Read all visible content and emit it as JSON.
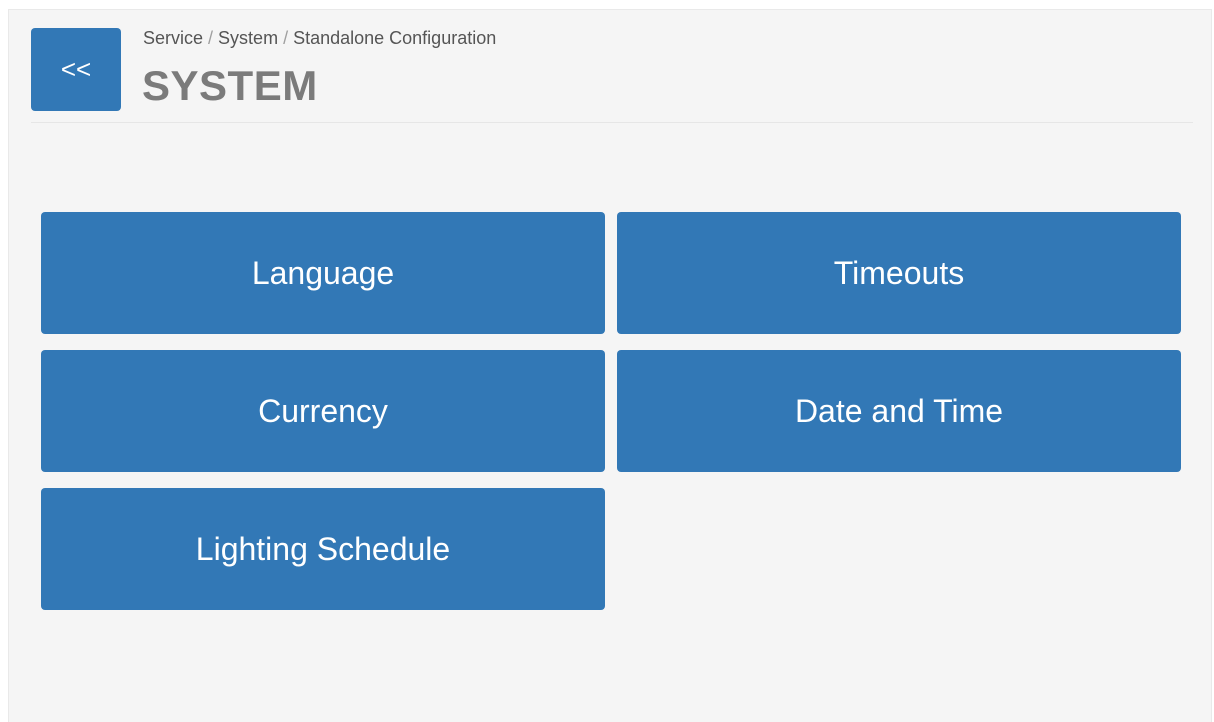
{
  "header": {
    "back_label": "<<",
    "breadcrumb": [
      "Service",
      "System",
      "Standalone Configuration"
    ],
    "breadcrumb_separator": "/",
    "title": "SYSTEM"
  },
  "menu": {
    "items": [
      {
        "label": "Language"
      },
      {
        "label": "Timeouts"
      },
      {
        "label": "Currency"
      },
      {
        "label": "Date and Time"
      },
      {
        "label": "Lighting Schedule"
      }
    ]
  },
  "colors": {
    "accent": "#3278b6",
    "background": "#f5f5f5",
    "title": "#7b7b7b",
    "breadcrumb": "#555555"
  }
}
